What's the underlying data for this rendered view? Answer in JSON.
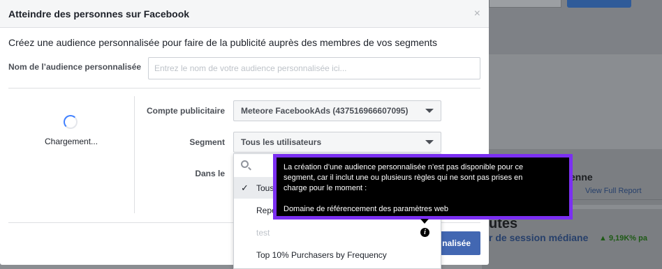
{
  "background": {
    "report_title": "enne",
    "view_full_report": "View Full Report",
    "section_title": "utes",
    "metric_label": "r de session médiane",
    "metric_delta": "▲ 9,19K% pa"
  },
  "modal": {
    "title": "Atteindre des personnes sur Facebook",
    "close_label": "×",
    "description": "Créez une audience personnalisée pour faire de la publicité auprès des membres de vos segments",
    "audience_name_label": "Nom de l’audience personnalisée",
    "audience_name_placeholder": "Entrez le nom de votre audience personnalisée ici...",
    "audience_name_value": "",
    "loading_text": "Chargement...",
    "ad_account_label": "Compte publicitaire",
    "ad_account_value": "Meteore FacebookAds (437516966607095)",
    "segment_label": "Segment",
    "segment_value": "Tous les utilisateurs",
    "within_label": "Dans le",
    "save_button_label": "nalisée"
  },
  "dropdown": {
    "items": [
      {
        "label": "Tous les utilisateurs",
        "selected": true,
        "disabled": false
      },
      {
        "label": "Repeat Purchasers",
        "selected": false,
        "disabled": false
      },
      {
        "label": "test",
        "selected": false,
        "disabled": true
      },
      {
        "label": "Top 10% Purchasers by Frequency",
        "selected": false,
        "disabled": false
      }
    ]
  },
  "tooltip": {
    "line1": "La création d’une audience personnalisée n’est pas disponible pour ce",
    "line2": "segment, car il inclut une ou plusieurs règles qui ne sont pas prises en",
    "line3": "charge pour le moment :",
    "line4": "Domaine de référencement des paramètres web"
  },
  "colors": {
    "primary_button": "#4267b2",
    "tooltip_border": "#7b2ff2",
    "tooltip_bg": "#000000"
  }
}
